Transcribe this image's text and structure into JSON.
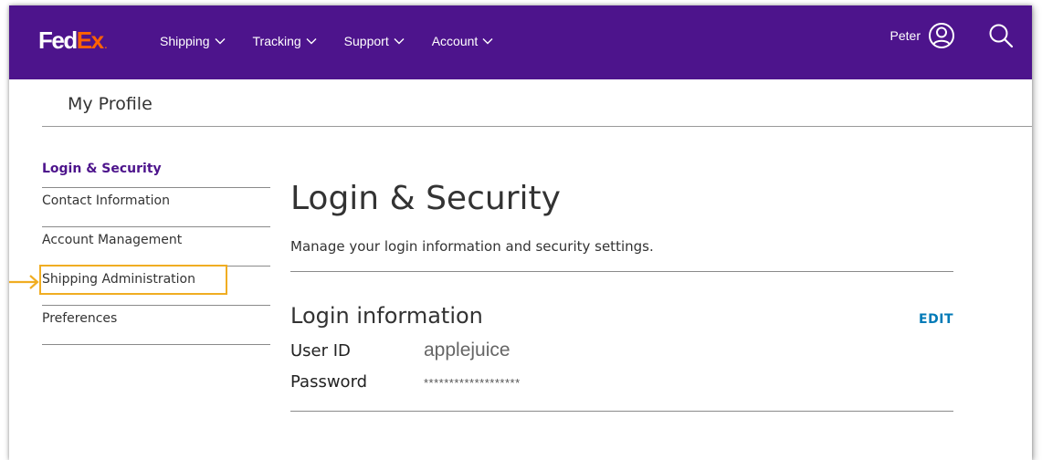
{
  "brand": {
    "logo_fed": "Fed",
    "logo_ex": "Ex",
    "logo_dot": ".",
    "purple": "#4d148c",
    "orange": "#ff6200",
    "highlight": "#f0ad22"
  },
  "nav": {
    "items": [
      {
        "label": "Shipping"
      },
      {
        "label": "Tracking"
      },
      {
        "label": "Support"
      },
      {
        "label": "Account"
      }
    ],
    "user_name": "Peter",
    "user_icon": "user-circle-icon",
    "search_icon": "search-icon"
  },
  "profile": {
    "title": "My Profile"
  },
  "sidebar": {
    "items": [
      {
        "label": "Login & Security",
        "active": true
      },
      {
        "label": "Contact Information"
      },
      {
        "label": "Account Management"
      },
      {
        "label": "Shipping Administration",
        "highlighted": true
      },
      {
        "label": "Preferences"
      }
    ]
  },
  "main": {
    "title": "Login & Security",
    "description": "Manage your login information and security settings.",
    "section_title": "Login information",
    "edit_label": "EDIT",
    "fields": [
      {
        "label": "User ID",
        "value": "applejuice"
      },
      {
        "label": "Password",
        "value": "*******************"
      }
    ]
  }
}
